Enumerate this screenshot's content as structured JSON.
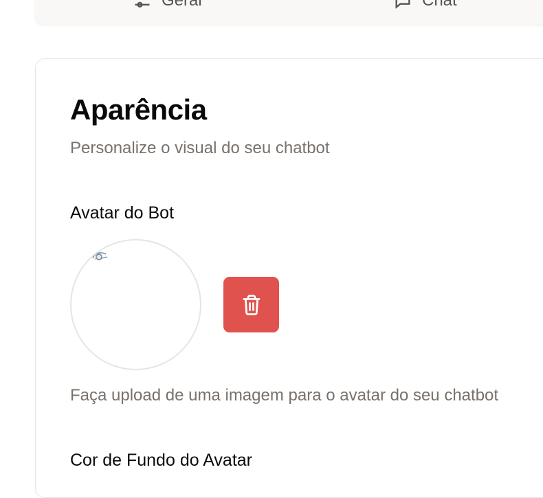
{
  "tabs": {
    "geral_label": "Geral",
    "chat_label": "Chat"
  },
  "appearance": {
    "title": "Aparência",
    "subtitle": "Personalize o visual do seu chatbot",
    "avatar_label": "Avatar do Bot",
    "avatar_help": "Faça upload de uma imagem para o avatar do seu chatbot",
    "avatar_bg_label": "Cor de Fundo do Avatar"
  },
  "colors": {
    "delete_button": "#e0524d"
  },
  "icons": {
    "geral": "settings-sliders-icon",
    "chat": "chat-bubble-icon",
    "delete": "trash-icon"
  }
}
